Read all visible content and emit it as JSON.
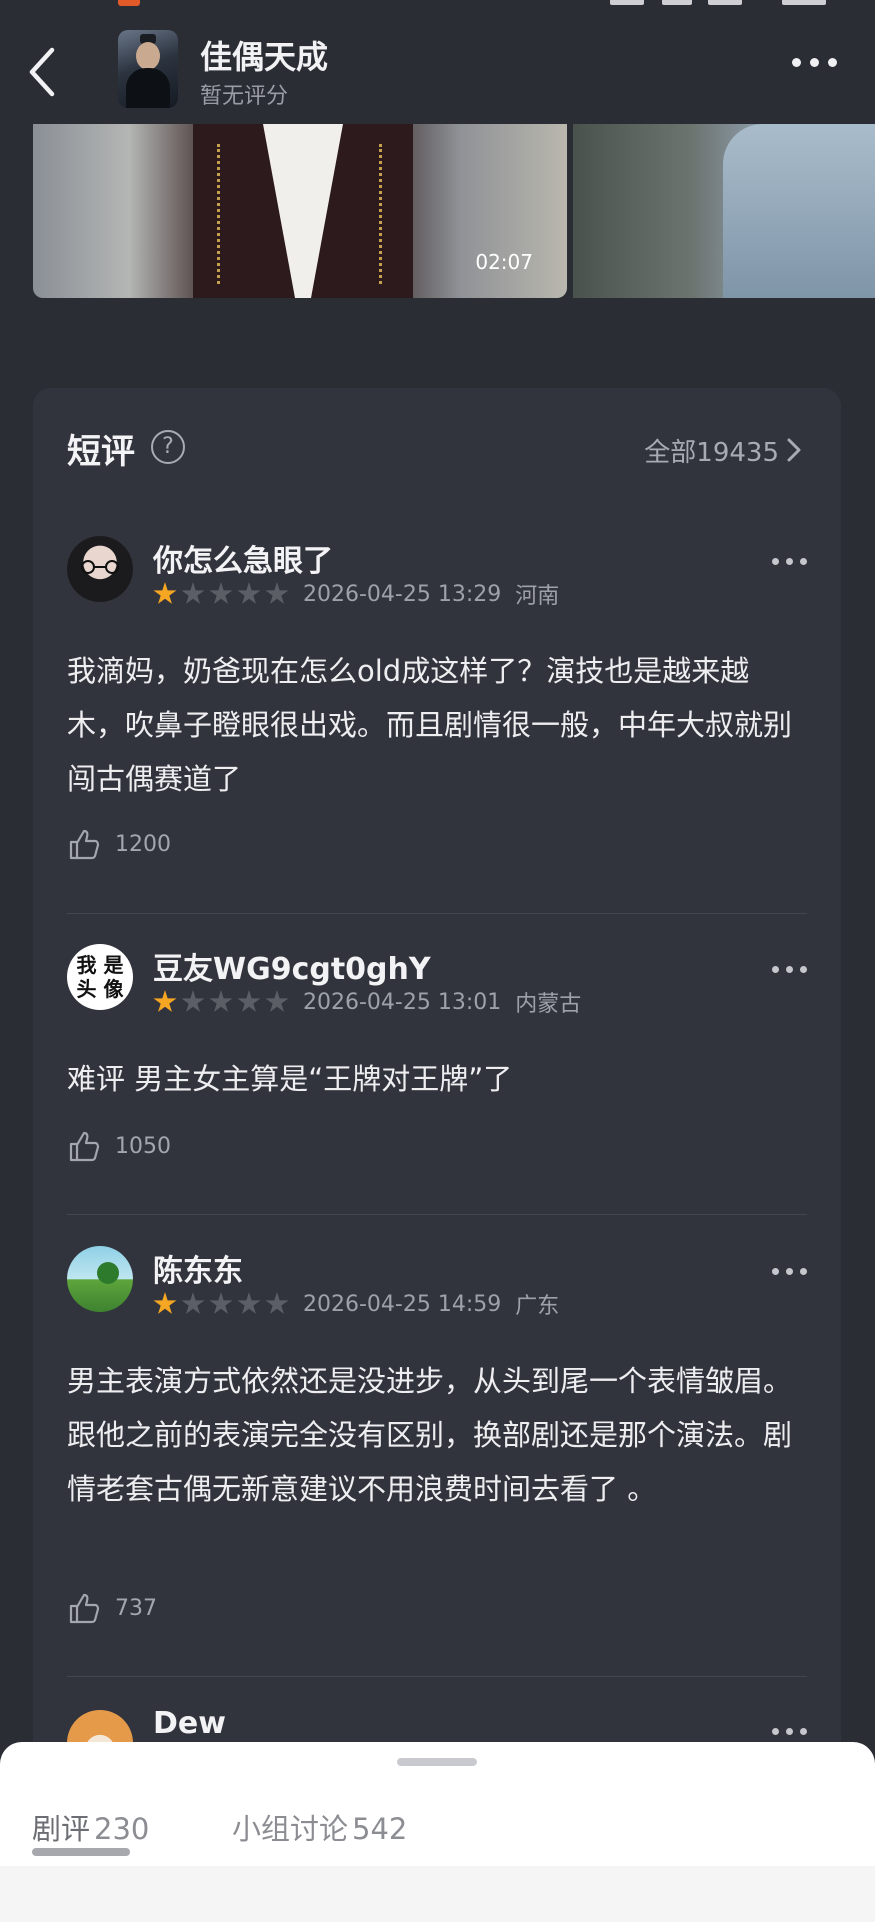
{
  "header": {
    "title": "佳偶天成",
    "subtitle": "暂无评分"
  },
  "media": {
    "video1_duration": "02:07"
  },
  "short_reviews": {
    "title": "短评",
    "all_label": "全部19435"
  },
  "reviews": [
    {
      "user": "你怎么急眼了",
      "rating": 1,
      "datetime": "2026-04-25 13:29",
      "location": "河南",
      "text": "我滴妈，奶爸现在怎么old成这样了？演技也是越来越木，吹鼻子瞪眼很出戏。而且剧情很一般，中年大叔就别闯古偶赛道了",
      "likes": "1200"
    },
    {
      "user": "豆友WG9cgt0ghY",
      "avatar_text": "我 是\n头 像",
      "rating": 1,
      "datetime": "2026-04-25 13:01",
      "location": "内蒙古",
      "text": "难评 男主女主算是“王牌对王牌”了",
      "likes": "1050"
    },
    {
      "user": "陈东东",
      "rating": 1,
      "datetime": "2026-04-25 14:59",
      "location": "广东",
      "text": "男主表演方式依然还是没进步，从头到尾一个表情皱眉。跟他之前的表演完全没有区别，换部剧还是那个演法。剧情老套古偶无新意建议不用浪费时间去看了 。",
      "likes": "737"
    },
    {
      "user": "Dew"
    }
  ],
  "bottom_tabs": [
    {
      "label": "剧评",
      "count": "230"
    },
    {
      "label": "小组讨论",
      "count": "542"
    }
  ],
  "colors": {
    "background": "#2b2d35",
    "card": "#32343d",
    "star_on": "#f5a623",
    "star_off": "#5c5e66"
  }
}
